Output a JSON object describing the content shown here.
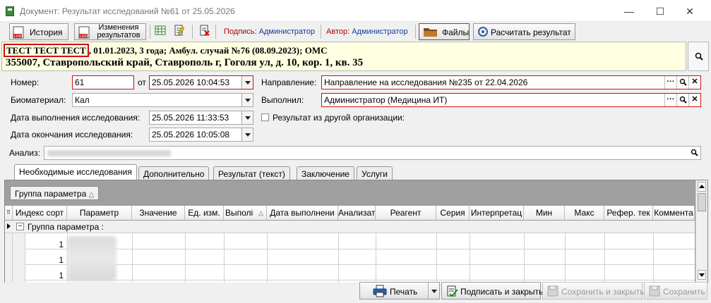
{
  "window": {
    "title": "Документ: Результат исследований №61 от 25.05.2026",
    "minimize": "—",
    "maximize": "☐",
    "close": "✕"
  },
  "toolbar": {
    "history": "История",
    "changes": "Изменения результатов",
    "signature_label": "Подпись:",
    "signature_value": "Администратор",
    "author_label": "Автор:",
    "author_value": "Администратор",
    "files": "Файлы",
    "calculate": "Расчитать результат"
  },
  "patient": {
    "name": "ТЕСТ ТЕСТ ТЕСТ",
    "info": ", 01.01.2023, 3 года; Амбул. случай №76 (08.09.2023); ОМС",
    "address": "355007, Ставропольский край, Ставрополь г, Гоголя ул, д. 10, кор. 1, кв. 35"
  },
  "form": {
    "number_label": "Номер:",
    "number_value": "61",
    "date_from_label": "от",
    "date_from_value": "25.05.2026 10:04:53",
    "direction_label": "Направление:",
    "direction_value": "Направление на исследования №235 от 22.04.2026",
    "biomaterial_label": "Биоматериал:",
    "biomaterial_value": "Кал",
    "performer_label": "Выполнил:",
    "performer_value": "Администратор (Медицина ИТ)",
    "exec_date_label": "Дата выполнения исследования:",
    "exec_date_value": "25.05.2026 11:33:53",
    "end_date_label": "Дата окончания исследования:",
    "end_date_value": "25.05.2026 10:05:08",
    "other_org_label": "Результат из другой организации:",
    "other_org_checked": false,
    "analysis_label": "Анализ:",
    "ellipsis": "···",
    "clear": "✕"
  },
  "tabs": [
    {
      "label": "Необходимые исследования",
      "active": true
    },
    {
      "label": "Дополнительно",
      "active": false
    },
    {
      "label": "Результат (текст)",
      "active": false
    },
    {
      "label": "Заключение",
      "active": false
    },
    {
      "label": "Услуги",
      "active": false
    }
  ],
  "grid": {
    "group_chip": "Группа параметра",
    "columns": [
      "Индекс сорт",
      "Параметр",
      "Значение",
      "Ед. изм.",
      "Выполі",
      "Дата выполнени",
      "Анализат",
      "Реагент",
      "Серия",
      "Интерпретац",
      "Мин",
      "Макс",
      "Рефер. тек",
      "Коммента"
    ],
    "group_row": "Группа параметра :",
    "rows": [
      {
        "index": "1"
      },
      {
        "index": "1"
      },
      {
        "index": "1"
      }
    ]
  },
  "footer": {
    "print": "Печать",
    "sign_close": "Подписать и закрыть",
    "save_close": "Сохранить и закрыть",
    "save": "Сохранить"
  }
}
